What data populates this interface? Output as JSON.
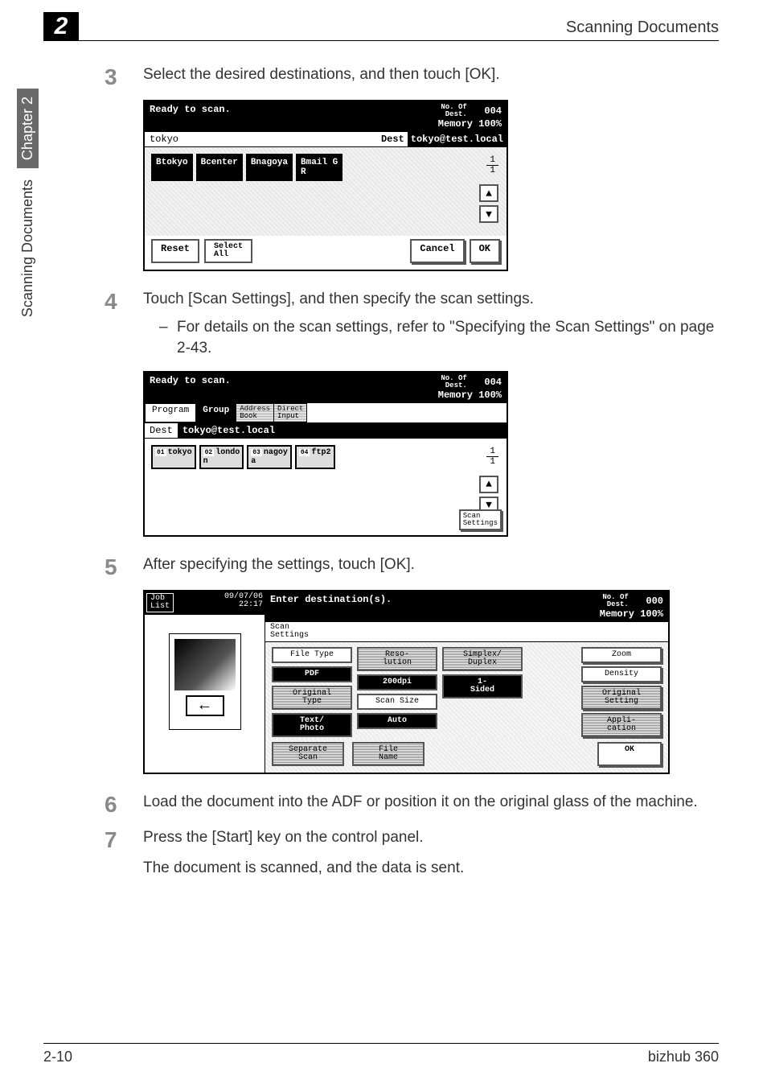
{
  "header": {
    "chapter_number": "2",
    "title": "Scanning Documents"
  },
  "side_tabs": {
    "upper": "Chapter 2",
    "lower": "Scanning Documents"
  },
  "steps": {
    "s3": {
      "num": "3",
      "text": "Select the desired destinations, and then touch [OK]."
    },
    "s4": {
      "num": "4",
      "text": "Touch [Scan Settings], and then specify the scan settings.",
      "sub": "For details on the scan settings, refer to \"Specifying the Scan Settings\" on page 2-43."
    },
    "s5": {
      "num": "5",
      "text": "After specifying the settings, touch [OK]."
    },
    "s6": {
      "num": "6",
      "text": "Load the document into the ADF or position it on the original glass of the machine."
    },
    "s7": {
      "num": "7",
      "text": "Press the [Start] key on the control panel.",
      "followup": "The document is scanned, and the data is sent."
    }
  },
  "lcd1": {
    "ready": "Ready to scan.",
    "dest_count_label": "No. Of\nDest.",
    "dest_count": "004",
    "memory": "Memory 100%",
    "filter": "tokyo",
    "dest_label": "Dest",
    "dest_value": "tokyo@test.local",
    "chips": [
      "Btokyo",
      "Bcenter",
      "Bnagoya",
      "Bmail G\nR"
    ],
    "frac_top": "1",
    "frac_bot": "1",
    "btn_reset": "Reset",
    "btn_select": "Select\nAll",
    "btn_cancel": "Cancel",
    "btn_ok": "OK"
  },
  "lcd2": {
    "ready": "Ready to scan.",
    "dest_count_label": "No. Of\nDest.",
    "dest_count": "004",
    "memory": "Memory 100%",
    "tabs": {
      "program": "Program",
      "group": "Group",
      "address": "Address\nBook",
      "direct": "Direct\nInput"
    },
    "dest_label": "Dest",
    "dest_value": "tokyo@test.local",
    "chips": [
      {
        "sup": "01",
        "label": "tokyo"
      },
      {
        "sup": "02",
        "label": "londo\nn"
      },
      {
        "sup": "03",
        "label": "nagoy\na"
      },
      {
        "sup": "04",
        "label": "ftp2"
      }
    ],
    "frac_top": "1",
    "frac_bot": "1",
    "scan_settings": "Scan\nSettings"
  },
  "lcd3": {
    "job_list": "Job\nList",
    "datetime": "09/07/06\n22:17",
    "enter": "Enter destination(s).",
    "dest_count_label": "No. Of\nDest.",
    "dest_count": "000",
    "memory": "Memory 100%",
    "scan_settings_label": "Scan\nSettings",
    "buttons": {
      "file_type": "File Type",
      "file_type_val": "PDF",
      "resolution": "Reso-\nlution",
      "resolution_val": "200dpi",
      "simplex": "Simplex/\nDuplex",
      "simplex_val": "1-\nSided",
      "original_type": "Original\nType",
      "original_type_val": "Text/\nPhoto",
      "scan_size": "Scan Size",
      "scan_size_val": "Auto",
      "zoom": "Zoom",
      "density": "Density",
      "original_setting": "Original\nSetting",
      "application": "Appli-\ncation",
      "separate": "Separate\nScan",
      "file_name": "File\nName",
      "ok": "OK"
    }
  },
  "footer": {
    "left": "2-10",
    "right": "bizhub 360"
  },
  "icons": {
    "up": "▲",
    "down": "▼",
    "left_arrow": "←"
  }
}
